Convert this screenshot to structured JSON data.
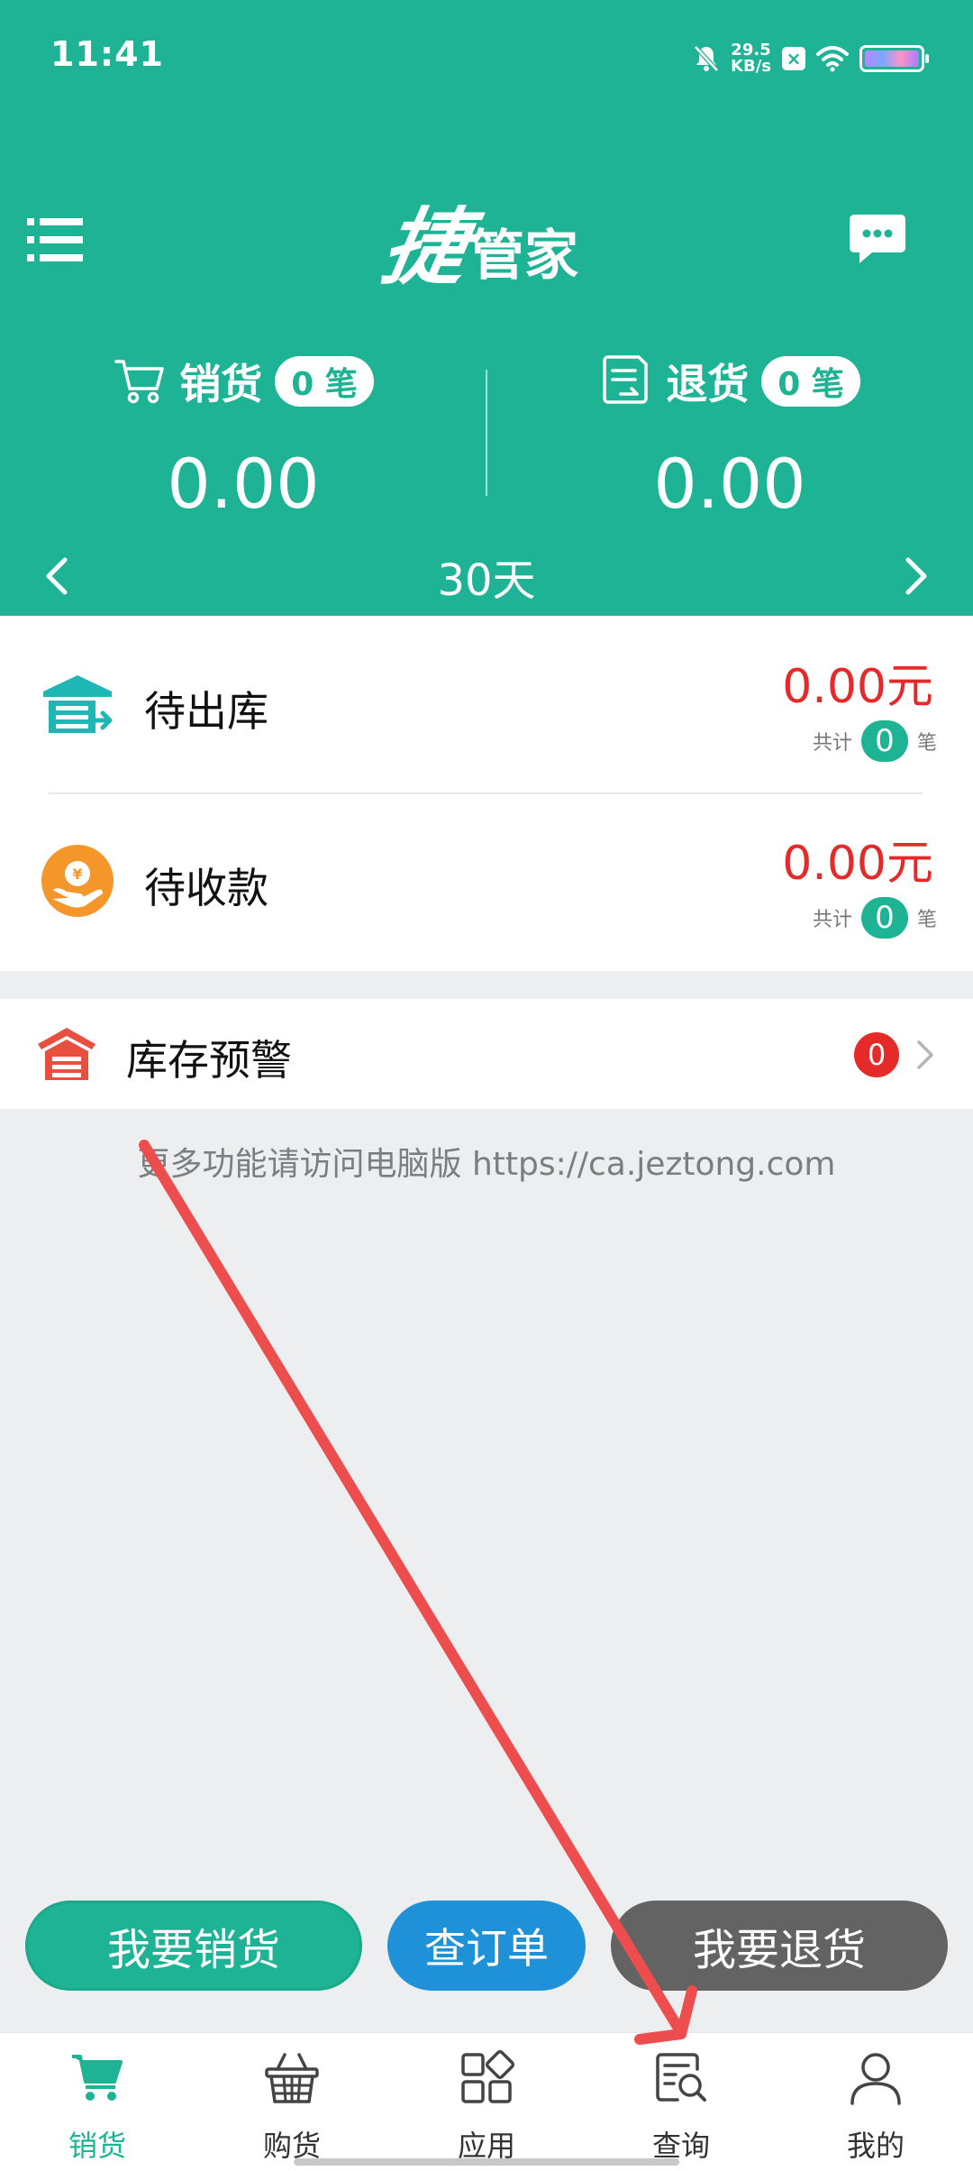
{
  "status_bar": {
    "time": "11:41",
    "net_speed_value": "29.5",
    "net_speed_unit": "KB/s",
    "x_badge": "×"
  },
  "header": {
    "logo_mark": "捷",
    "logo_text": "管家",
    "sales": {
      "label": "销货",
      "count_badge": "0 笔",
      "amount": "0.00"
    },
    "returns": {
      "label": "退货",
      "count_badge": "0 笔",
      "amount": "0.00"
    },
    "period": "30天"
  },
  "orders": {
    "pending_outbound": {
      "label": "待出库",
      "amount": "0.00元",
      "total_prefix": "共计",
      "count": "0",
      "count_unit": "笔"
    },
    "pending_payment": {
      "label": "待收款",
      "amount": "0.00元",
      "total_prefix": "共计",
      "count": "0",
      "count_unit": "笔"
    }
  },
  "stock_warning": {
    "label": "库存预警",
    "count": "0"
  },
  "pc_hint": "更多功能请访问电脑版 https://ca.jeztong.com",
  "actions": {
    "sale": "我要销货",
    "query": "查订单",
    "return": "我要退货"
  },
  "tabs": [
    {
      "label": "销货"
    },
    {
      "label": "购货"
    },
    {
      "label": "应用"
    },
    {
      "label": "查询"
    },
    {
      "label": "我的"
    }
  ],
  "colors": {
    "primary": "#1db394",
    "danger": "#e62a2a",
    "blue": "#1f91d9",
    "gray_button": "#636363",
    "annotation_arrow": "#ee4d4d"
  }
}
